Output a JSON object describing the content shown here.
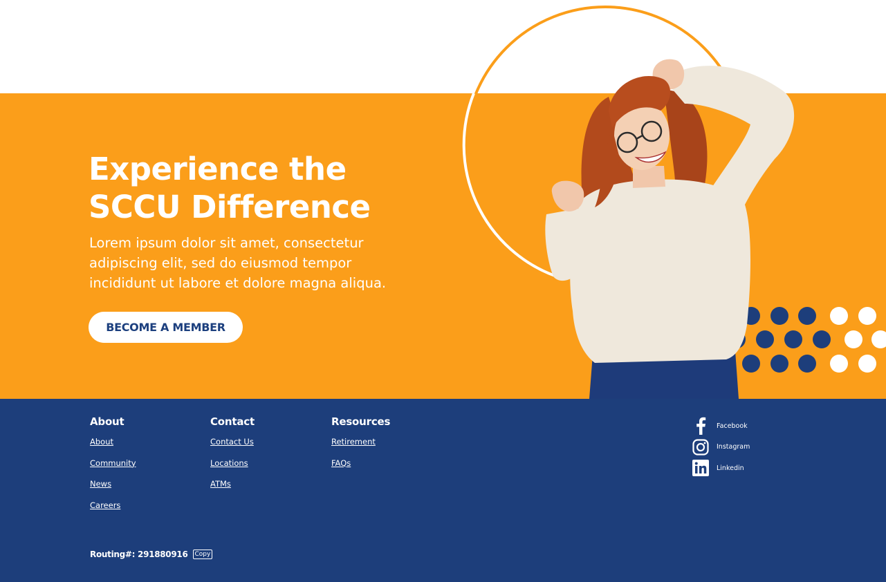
{
  "hero": {
    "title_line1": "Experience the",
    "title_line2": "SCCU Difference",
    "body": "Lorem ipsum dolor sit amet, consectetur adipiscing elit, sed do eiusmod tempor incididunt ut labore et dolore magna aliqua.",
    "cta_label": "BECOME A MEMBER"
  },
  "footer": {
    "columns": [
      {
        "heading": "About",
        "links": [
          "About",
          "Community",
          "News",
          "Careers"
        ]
      },
      {
        "heading": "Contact",
        "links": [
          "Contact Us",
          "Locations",
          "ATMs"
        ]
      },
      {
        "heading": "Resources",
        "links": [
          "Retirement",
          "FAQs"
        ]
      }
    ],
    "social": [
      {
        "icon": "facebook-icon",
        "label": "Facebook"
      },
      {
        "icon": "instagram-icon",
        "label": "Instagram"
      },
      {
        "icon": "linkedin-icon",
        "label": "Linkedin"
      }
    ],
    "routing_text": "Routing#: 291880916",
    "copy_label": "Copy"
  },
  "colors": {
    "orange": "#fb9e1a",
    "navy": "#1d3e7b",
    "white": "#ffffff"
  }
}
